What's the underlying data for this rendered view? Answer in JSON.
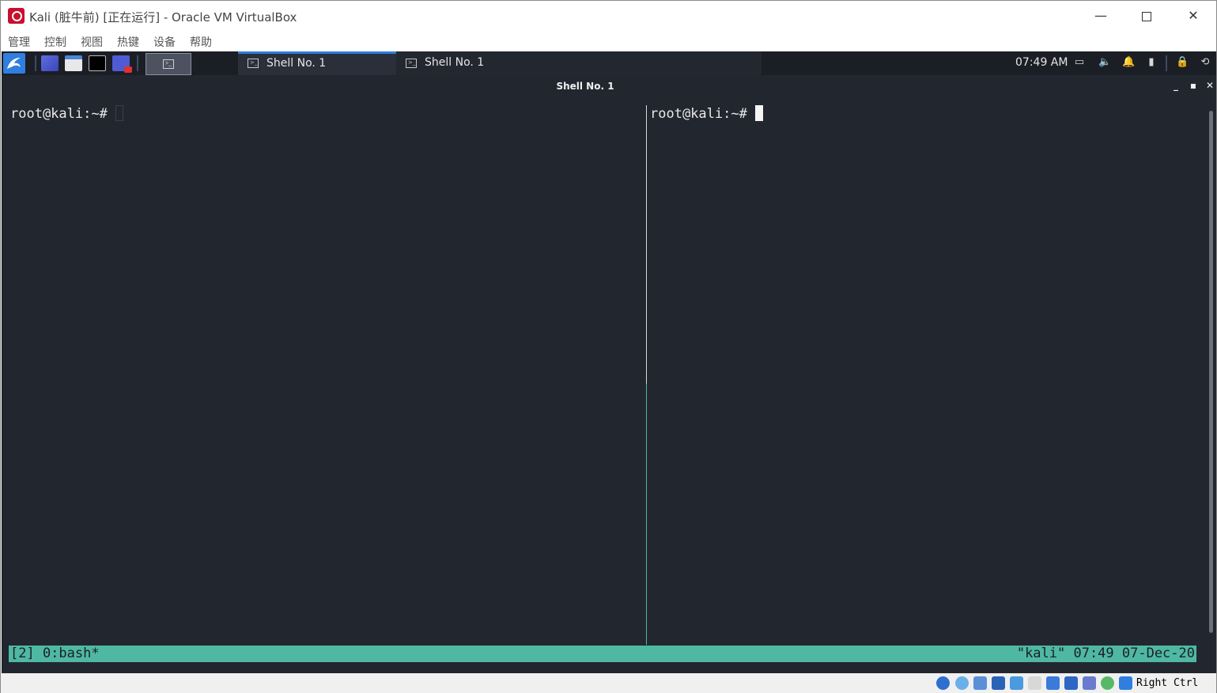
{
  "window": {
    "title": "Kali (脏牛前) [正在运行] - Oracle VM VirtualBox",
    "min_label": "—",
    "close_label": "✕"
  },
  "menubar": {
    "items": [
      "管理",
      "控制",
      "视图",
      "热键",
      "设备",
      "帮助"
    ]
  },
  "panel": {
    "tasks": [
      {
        "label": "Shell No. 1",
        "active": true
      },
      {
        "label": "Shell No. 1",
        "active": false
      }
    ],
    "clock": "07:49 AM",
    "tray_icons": [
      "display-icon",
      "volume-icon",
      "notification-bell-icon",
      "battery-icon",
      "lock-icon",
      "logout-icon"
    ]
  },
  "terminal": {
    "title": "Shell No. 1",
    "controls": {
      "minimize": "_",
      "maximize": "▪",
      "close": "✕"
    },
    "left_prompt": "root@kali:~#",
    "right_prompt": "root@kali:~#",
    "tmux_left": "[2] 0:bash*",
    "tmux_right": "\"kali\" 07:49 07-Dec-20"
  },
  "vbox_status": {
    "host_key": "Right Ctrl",
    "icons": [
      "hard-disk-icon",
      "optical-drive-icon",
      "audio-icon",
      "network-icon",
      "usb-icon",
      "shared-folders-icon",
      "display-icon",
      "recording-icon",
      "cpu-icon",
      "mouse-integration-icon",
      "keyboard-capture-icon"
    ]
  },
  "colors": {
    "terminal_bg": "#22262f",
    "tmux_status": "#4fb8a3",
    "panel_bg": "#1b1e24",
    "accent": "#2f7ee0"
  }
}
